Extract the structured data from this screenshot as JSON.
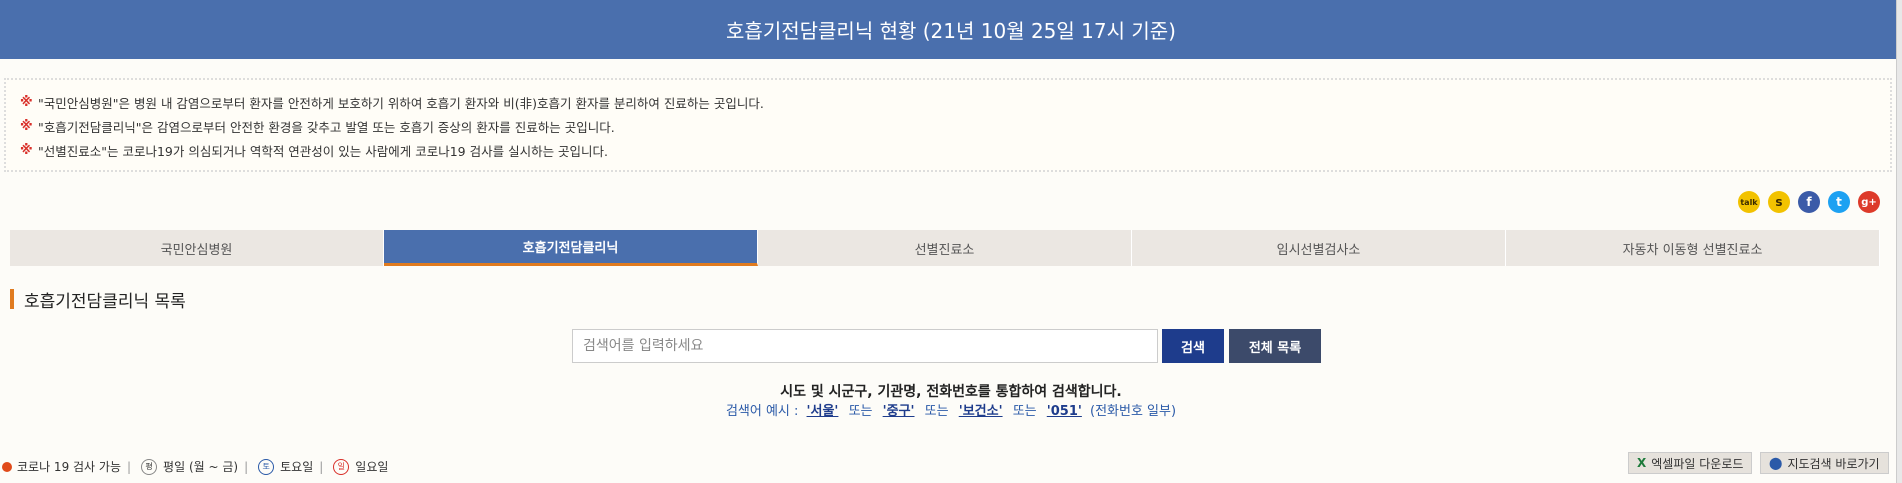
{
  "banner": {
    "title": "호흡기전담클리닉 현황 (21년 10월 25일 17시 기준)"
  },
  "notices": [
    {
      "mark": "※",
      "text": "\"국민안심병원\"은 병원 내 감염으로부터 환자를 안전하게 보호하기 위하여 호흡기 환자와 비(非)호흡기 환자를 분리하여 진료하는 곳입니다."
    },
    {
      "mark": "※",
      "text": "\"호흡기전담클리닉\"은 감염으로부터 안전한 환경을 갖추고 발열 또는 호흡기 증상의 환자를 진료하는 곳입니다."
    },
    {
      "mark": "※",
      "text": "\"선별진료소\"는 코로나19가 의심되거나 역학적 연관성이 있는 사람에게 코로나19 검사를 실시하는 곳입니다."
    }
  ],
  "share": [
    {
      "name": "kakaotalk-icon",
      "glyph": "talk",
      "color": "#f2c200"
    },
    {
      "name": "kakaostory-icon",
      "glyph": "s",
      "color": "#f2c200"
    },
    {
      "name": "facebook-icon",
      "glyph": "f",
      "color": "#3b5ba8"
    },
    {
      "name": "twitter-icon",
      "glyph": "t",
      "color": "#1da1f2"
    },
    {
      "name": "googleplus-icon",
      "glyph": "g+",
      "color": "#dd3a2a"
    }
  ],
  "tabs": [
    {
      "label": "국민안심병원",
      "active": false
    },
    {
      "label": "호흡기전담클리닉",
      "active": true
    },
    {
      "label": "선별진료소",
      "active": false
    },
    {
      "label": "임시선별검사소",
      "active": false
    },
    {
      "label": "자동차 이동형 선별진료소",
      "active": false
    }
  ],
  "section": {
    "title": "호흡기전담클리닉 목록"
  },
  "search": {
    "placeholder": "검색어를 입력하세요",
    "search_label": "검색",
    "all_label": "전체 목록",
    "hint": "시도 및 시군구, 기관명, 전화번호를 통합하여 검색합니다.",
    "example_prefix": "검색어 예시 :",
    "examples": [
      "'서울'",
      "'중구'",
      "'보건소'",
      "'051'"
    ],
    "or": "또는",
    "example_suffix": "(전화번호 일부)"
  },
  "legend": {
    "covid_test": "코로나 19 검사 가능",
    "weekday": "평일 (월 ~ 금)",
    "saturday": "토요일",
    "sunday": "일요일",
    "weekday_glyph": "평",
    "saturday_glyph": "토",
    "sunday_glyph": "일"
  },
  "utilities": {
    "excel": "엑셀파일 다운로드",
    "map": "지도검색 바로가기"
  },
  "colors": {
    "primary": "#4a6fad",
    "accent": "#e07b1f",
    "search": "#1e3c8c"
  }
}
